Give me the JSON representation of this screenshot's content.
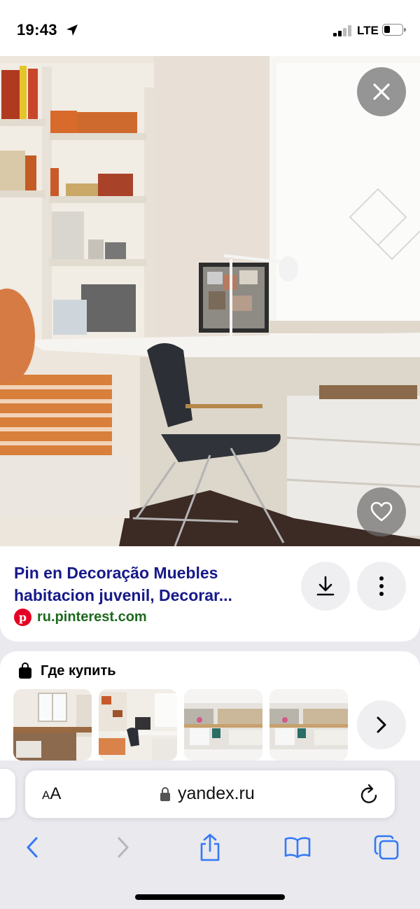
{
  "status_bar": {
    "time": "19:43",
    "network": "LTE",
    "icons": [
      "location-arrow-icon",
      "signal-icon",
      "battery-icon"
    ]
  },
  "pin": {
    "title": "Pin en Decoração Muebles habitacion juvenil, Decorar...",
    "source_domain": "ru.pinterest.com",
    "source_logo_letter": "p"
  },
  "buttons": {
    "close": "close-icon",
    "favorite": "heart-icon",
    "download": "download-icon",
    "more": "more-vertical-icon"
  },
  "where_to_buy": {
    "title": "Где купить",
    "icon": "shopping-bag-icon",
    "next": "chevron-right-icon"
  },
  "browser": {
    "text_size_label_small": "A",
    "text_size_label_large": "A",
    "url": "yandex.ru",
    "toolbar": [
      "back-icon",
      "forward-icon",
      "share-icon",
      "bookmarks-icon",
      "tabs-icon"
    ]
  },
  "colors": {
    "title_blue": "#16198a",
    "domain_green": "#1d6a1d",
    "pinterest_red": "#e60023",
    "ios_blue": "#3478f6"
  }
}
